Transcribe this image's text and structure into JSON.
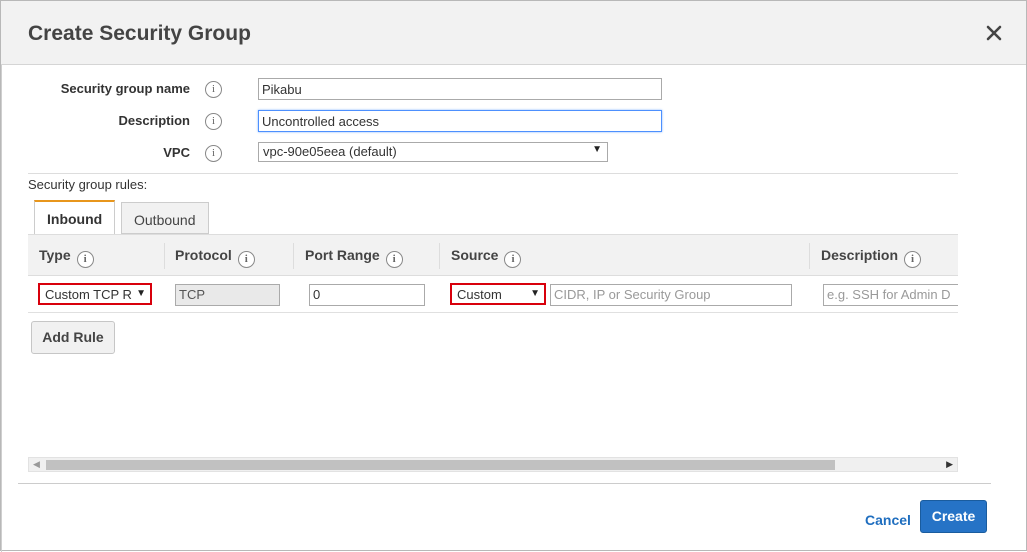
{
  "dialog": {
    "title": "Create Security Group",
    "close_icon": "close-icon"
  },
  "form": {
    "name_label": "Security group name",
    "name_value": "Pikabu",
    "description_label": "Description",
    "description_value": "Uncontrolled access",
    "vpc_label": "VPC",
    "vpc_value": "vpc-90e05eea (default)",
    "info_glyph": "i"
  },
  "rules": {
    "section_label": "Security group rules:",
    "tabs": [
      {
        "label": "Inbound",
        "active": true
      },
      {
        "label": "Outbound",
        "active": false
      }
    ],
    "columns": [
      "Type",
      "Protocol",
      "Port Range",
      "Source",
      "Description"
    ],
    "row": {
      "type": "Custom TCP R",
      "protocol": "TCP",
      "port_range": "0",
      "source": "Custom",
      "source_placeholder": "CIDR, IP or Security Group",
      "description_placeholder": "e.g. SSH for Admin D"
    },
    "add_rule_label": "Add Rule"
  },
  "footer": {
    "cancel_label": "Cancel",
    "create_label": "Create"
  },
  "colors": {
    "accent": "#2673c6",
    "highlight_red": "#d8000c",
    "tab_accent": "#e8961c"
  }
}
